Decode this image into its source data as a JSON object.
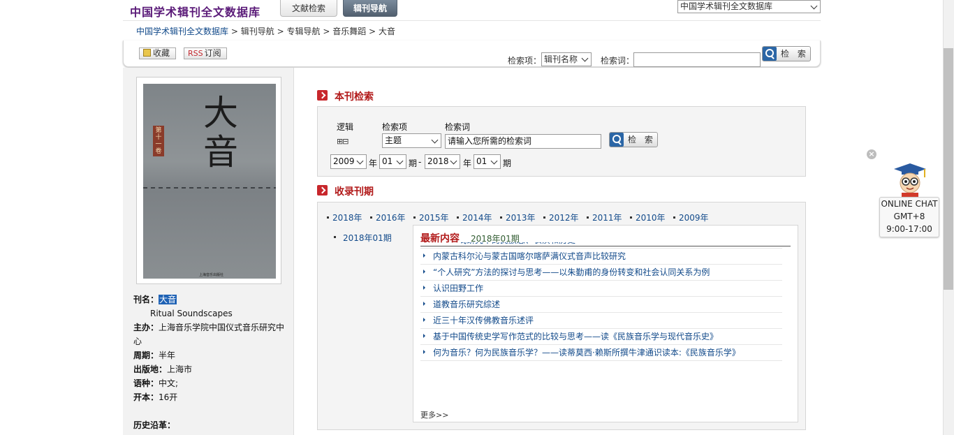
{
  "header": {
    "logo": "中国学术辑刊全文数据库",
    "tabs": [
      "文献检索",
      "辑刊导航"
    ],
    "db_select": "中国学术辑刊全文数据库"
  },
  "breadcrumb": {
    "items": [
      "中国学术辑刊全文数据库",
      "辑刊导航",
      "专辑导航",
      "音乐舞蹈",
      "大音"
    ],
    "sep": ">"
  },
  "toolbar": {
    "favorite": "收藏",
    "rss_word": "RSS",
    "subscribe": "订阅",
    "field_label": "检索项：",
    "field_value": "辑刊名称",
    "keyword_label": "检索词：",
    "keyword_value": "",
    "search_button": "检 索"
  },
  "cover": {
    "title_glyph": "大\n音",
    "volume": "第十一卷",
    "publisher": "上海音乐出版社"
  },
  "journal": {
    "name_label": "刊名：",
    "name": "大音",
    "english_name": "Ritual Soundscapes",
    "sponsor_label": "主办：",
    "sponsor": "上海音乐学院中国仪式音乐研究中心",
    "period_label": "周期：",
    "period": "半年",
    "place_label": "出版地：",
    "place": "上海市",
    "lang_label": "语种：",
    "lang": "中文;",
    "format_label": "开本：",
    "format": "16开",
    "history_label": "历史沿革："
  },
  "search": {
    "section_title": "本刊检索",
    "logic_header": "逻辑",
    "field_header": "检索项",
    "keyword_header": "检索词",
    "plusminus": "⊞⊟",
    "field_value": "主题",
    "keyword_value": "请输入您所需的检索词",
    "button": "检 索",
    "year_from": "2009",
    "issue_from": "01",
    "year_to": "2018",
    "issue_to": "01",
    "year_unit": "年",
    "issue_unit": "期",
    "dash": "-"
  },
  "periods": {
    "section_title": "收录刊期",
    "years": [
      "2018年",
      "2016年",
      "2015年",
      "2014年",
      "2013年",
      "2012年",
      "2011年",
      "2010年",
      "2009年"
    ],
    "issue": "2018年01期"
  },
  "latest": {
    "title": "最新内容",
    "date": "2018年01期",
    "articles": [
      "道教仪式研究中的民族志、表演和历史",
      "内蒙古科尔沁与蒙古国喀尔喀萨满仪式音声比较研究",
      "“个人研究”方法的探讨与思考——以朱勤甫的身份转变和社会认同关系为例",
      "认识田野工作",
      "道教音乐研究综述",
      "近三十年汉传佛教音乐述评",
      "基于中国传统史学写作范式的比较与思考——读《民族音乐学与现代音乐史》",
      "何为音乐？何为民族音乐学？——读蒂莫西·赖斯所撰牛津通识读本:《民族音乐学》"
    ],
    "more": "更多>>"
  },
  "chat": {
    "close": "×",
    "line1": "ONLINE CHAT",
    "line2": "GMT+8",
    "line3": "9:00-17:00"
  }
}
